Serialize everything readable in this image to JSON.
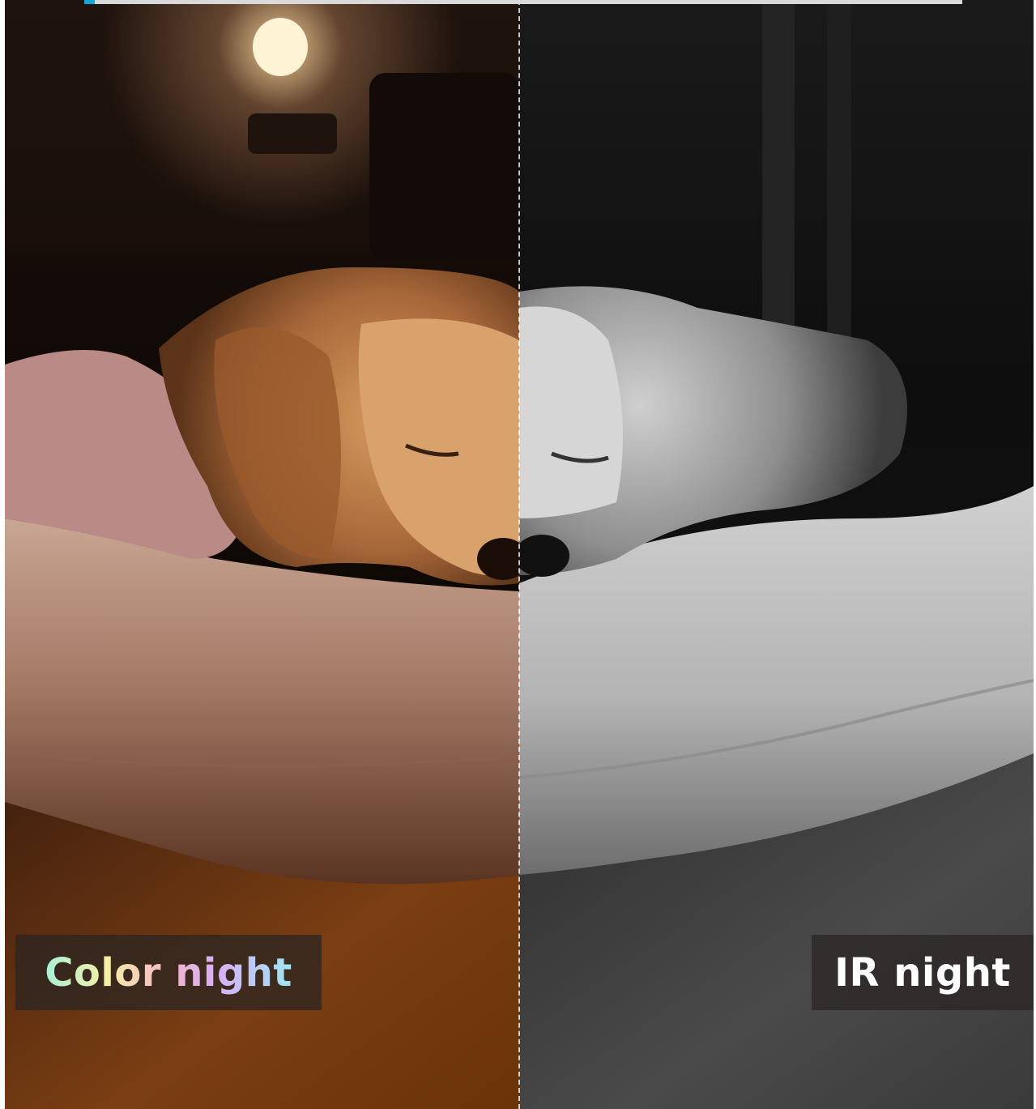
{
  "progress": {
    "fraction": 0.012,
    "fill_color": "#18a6d6",
    "track_color": "#d9d9d9"
  },
  "comparison": {
    "left_label": "Color night",
    "right_label": "IR night"
  },
  "photo": {
    "subject_icon": "sleeping-dog-on-cushion"
  }
}
